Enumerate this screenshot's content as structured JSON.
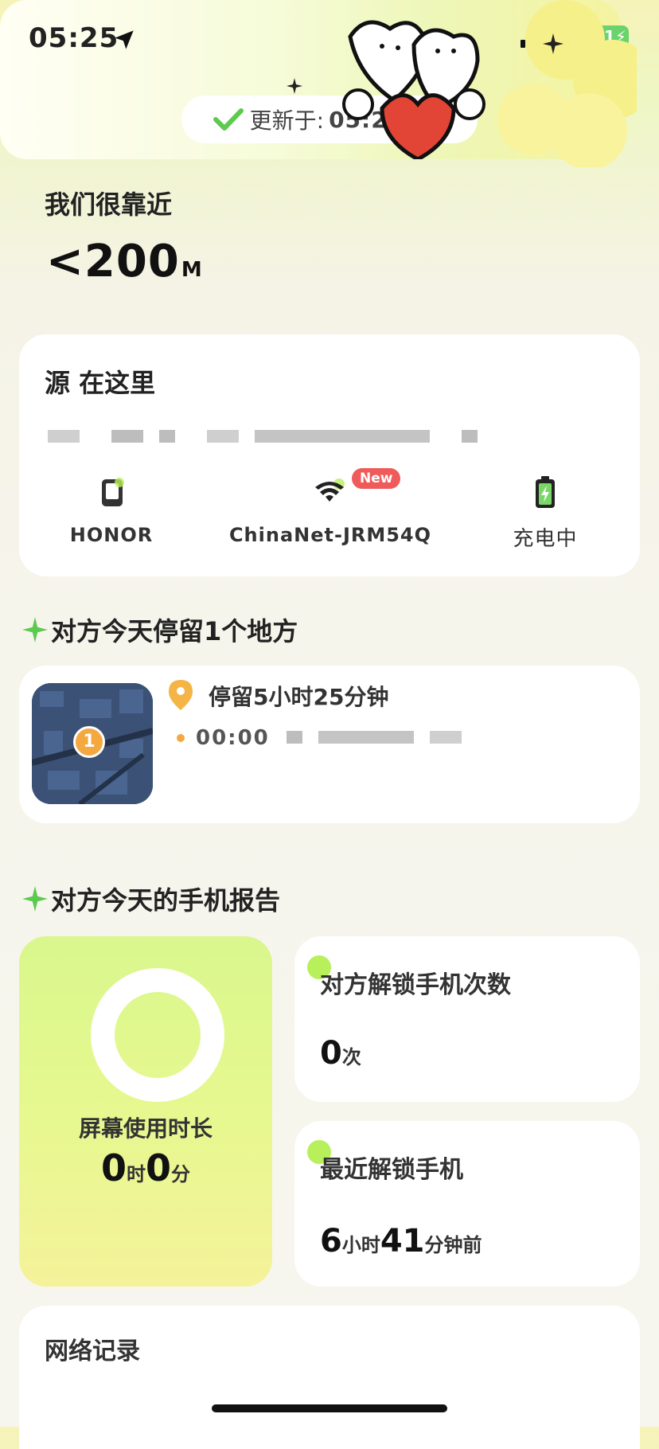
{
  "status_bar": {
    "time": "05:25",
    "battery": "71"
  },
  "update": {
    "label": "更新于:",
    "time": "05:25:13"
  },
  "distance": {
    "title": "我们很靠近",
    "value": "<200",
    "unit": "M"
  },
  "source": {
    "title": "源 在这里",
    "devices": [
      {
        "label": "HONOR",
        "icon": "phone-icon"
      },
      {
        "label": "ChinaNet-JRM54Q",
        "icon": "wifi-icon",
        "badge": "New"
      },
      {
        "label": "充电中",
        "icon": "battery-charging-icon"
      }
    ]
  },
  "stay_section": {
    "title": "对方今天停留1个地方",
    "item": {
      "marker": "1",
      "duration": "停留5小时25分钟",
      "time": "00:00"
    }
  },
  "report_section": {
    "title": "对方今天的手机报告",
    "screen_time": {
      "label": "屏幕使用时长",
      "hours": "0",
      "hours_unit": "时",
      "minutes": "0",
      "minutes_unit": "分"
    },
    "unlock_count": {
      "label": "对方解锁手机次数",
      "value": "0",
      "unit": "次"
    },
    "last_unlock": {
      "label": "最近解锁手机",
      "hours": "6",
      "hours_unit": "小时",
      "minutes": "41",
      "minutes_unit": "分钟前"
    }
  },
  "network": {
    "title": "网络记录"
  },
  "colors": {
    "accent_green": "#b7f05a",
    "badge_red": "#ef5a5a",
    "orange": "#f4a940"
  }
}
